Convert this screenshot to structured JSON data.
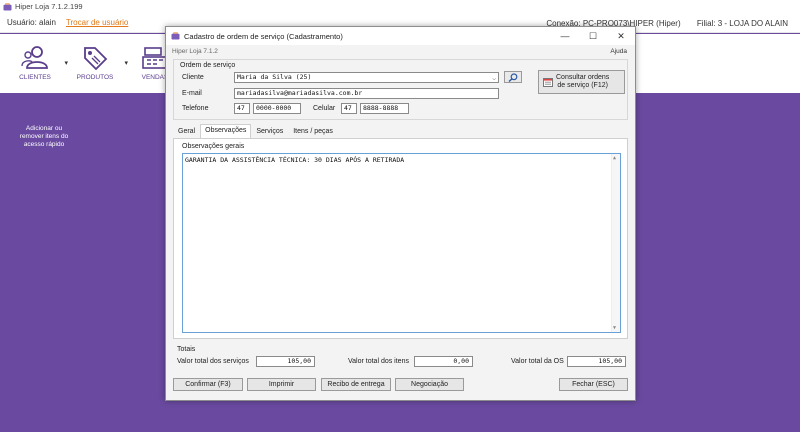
{
  "app": {
    "title": "Hiper Loja 7.1.2.199",
    "user_label": "Usuário: alain",
    "switch_user": "Trocar de usuário",
    "connection": "Conexão:  PC-PRO073\\HIPER (Hiper)",
    "branch": "Filial:  3 - LOJA DO ALAIN"
  },
  "toolbar": {
    "clientes": "CLIENTES",
    "produtos": "PRODUTOS",
    "vendas": "VENDAS"
  },
  "sidebar_hint": "Adicionar ou remover itens do acesso rápido",
  "dialog": {
    "title": "Cadastro de ordem de serviço (Cadastramento)",
    "minimize": "—",
    "maximize": "☐",
    "close": "✕",
    "subtitle": "Hiper Loja 7.1.2",
    "help": "Ajuda",
    "group_title": "Ordem de serviço",
    "cliente_label": "Cliente",
    "cliente_value": "Maria da Silva (25)",
    "email_label": "E-mail",
    "email_value": "mariadasilva@mariadasilva.com.br",
    "telefone_label": "Telefone",
    "telefone_ddd": "47",
    "telefone_num": "0000-0000",
    "celular_label": "Celular",
    "celular_ddd": "47",
    "celular_num": "8888-8888",
    "consult_line1": "Consultar ordens",
    "consult_line2": "de serviço (F12)",
    "tabs": [
      "Geral",
      "Observações",
      "Serviços",
      "Itens / peças"
    ],
    "obs_label": "Observações gerais",
    "obs_text": "GARANTIA DA ASSISTÊNCIA TÉCNICA: 30 DIAS APÓS A RETIRADA",
    "totais_title": "Totais",
    "total_servicos_label": "Valor total dos serviços",
    "total_servicos_value": "105,00",
    "total_itens_label": "Valor total dos itens",
    "total_itens_value": "0,00",
    "total_os_label": "Valor total da OS",
    "total_os_value": "105,00",
    "buttons": {
      "confirmar": "Confirmar (F3)",
      "imprimir": "Imprimir",
      "recibo": "Recibo de entrega",
      "negociacao": "Negociação",
      "fechar": "Fechar (ESC)"
    }
  },
  "colors": {
    "brand_purple": "#6a4aa0",
    "link_orange": "#e07a1a",
    "focus_blue": "#6aa0d8"
  }
}
